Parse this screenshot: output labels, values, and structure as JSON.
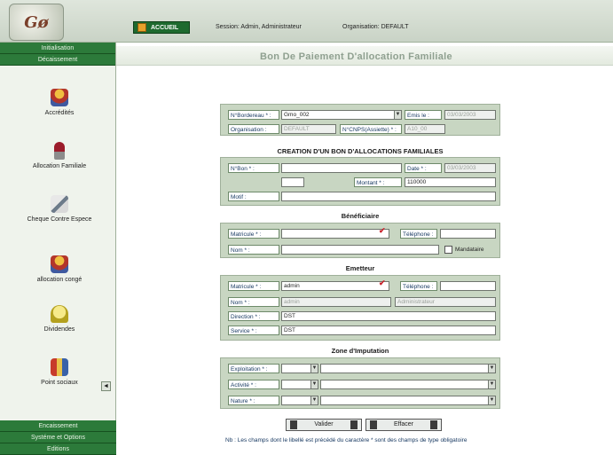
{
  "header": {
    "logo_text": "Gø",
    "accueil_label": "ACCUEIL",
    "session": "Session: Admin, Administrateur",
    "organisation": "Organisation: DEFAULT"
  },
  "sidebar": {
    "top_items": [
      "Initialisation",
      "Décaissement"
    ],
    "items": [
      {
        "label": "Accrédités",
        "icon": "person-icon"
      },
      {
        "label": "Allocation Familiale",
        "icon": "wine-glass-icon"
      },
      {
        "label": "Cheque Contre Espece",
        "icon": "cheque-pen-icon"
      },
      {
        "label": "allocation congé",
        "icon": "person-icon"
      },
      {
        "label": "Dividendes",
        "icon": "bell-icon"
      },
      {
        "label": "Point sociaux",
        "icon": "package-icon"
      }
    ],
    "bottom_items": [
      "Encaissement",
      "Systéme et Options",
      "Editions"
    ]
  },
  "main": {
    "title": "Bon De Paiement D'allocation Familiale"
  },
  "form": {
    "bordereau_label": "N°Bordereau * :",
    "bordereau_value": "Gmo_002",
    "emis_le_label": "Emis le :",
    "emis_le_value": "03/03/2003",
    "organisation_label": "Organisation :",
    "organisation_value": "DEFAULT",
    "ncompte_label": "N°CNPS(Assiette) * :",
    "ncompte_value": "A10_00",
    "creation_title": "CREATION D'UN BON D'ALLOCATIONS FAMILIALES",
    "num_bon_label": "N°Bon * :",
    "num_bon_value": "",
    "date_label": "Date * :",
    "date_value": "03/03/2003",
    "montant_label": "Montant * :",
    "montant_value": "110000",
    "motif_label": "Motif :",
    "motif_value": "",
    "beneficiaire_title": "Bénéficiaire",
    "ben_matricule_label": "Matricule * :",
    "ben_matricule_value": "",
    "ben_telephone_label": "Téléphone :",
    "ben_telephone_value": "",
    "ben_nom_label": "Nom * :",
    "ben_nom_value": "",
    "mandataire_label": "Mandataire",
    "emetteur_title": "Emetteur",
    "em_matricule_label": "Matricule * :",
    "em_matricule_value": "admin",
    "em_telephone_label": "Téléphone :",
    "em_telephone_value": "",
    "em_nom_label": "Nom * :",
    "em_nom_value": "admin",
    "em_nom_value2": "Administrateur",
    "em_direction_label": "Direction * :",
    "em_direction_value": "DST",
    "em_service_label": "Service * :",
    "em_service_value": "DST",
    "imputation_title": "Zone d'Imputation",
    "exploitation_label": "Exploitation * :",
    "activite_label": "Activité * :",
    "nature_label": "Nature * :",
    "valider_label": "Valider",
    "effacer_label": "Effacer",
    "note": "Nb : Les champs dont le libellé est précédé du caractère * sont des champs de type obligatoire"
  }
}
